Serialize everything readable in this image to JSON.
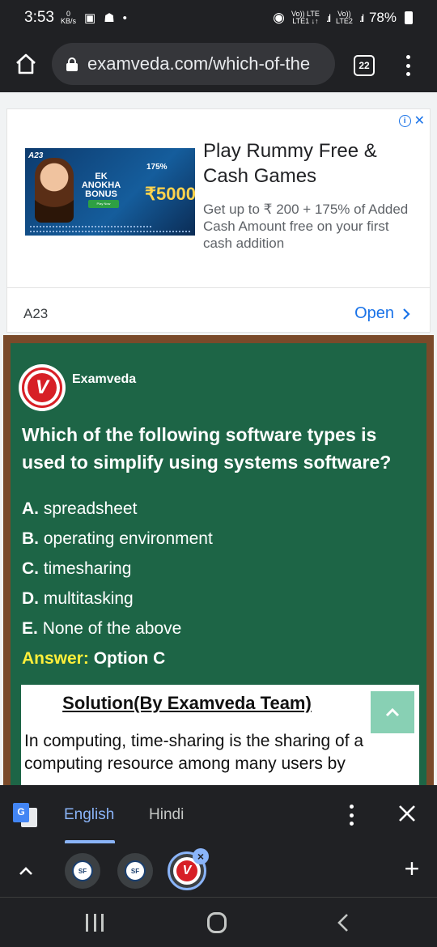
{
  "status_bar": {
    "time": "3:53",
    "net_speed_value": "0",
    "net_speed_unit": "KB/s",
    "lte1": "Vo)) LTE",
    "lte1_sub": "LTE1 ↓↑",
    "lte2": "Vo))",
    "lte2_sub": "LTE2",
    "battery": "78%"
  },
  "browser": {
    "url": "examveda.com/which-of-the",
    "tab_count": "22"
  },
  "ad": {
    "image": {
      "logo": "A23",
      "bonus_text": "EK ANOKHA BONUS",
      "percent": "175%",
      "amount": "₹5000",
      "button": "Play Now"
    },
    "title": "Play Rummy Free & Cash Games",
    "description": "Get up to ₹ 200 + 175% of Added Cash Amount free on your first cash addition",
    "advertiser": "A23",
    "open_label": "Open"
  },
  "content": {
    "brand_name": "Examveda",
    "brand_logo_letter": "V",
    "question": "Which of the following software types is used to simplify using systems software?",
    "options": [
      {
        "letter": "A.",
        "text": "spreadsheet"
      },
      {
        "letter": "B.",
        "text": "operating environment"
      },
      {
        "letter": "C.",
        "text": "timesharing"
      },
      {
        "letter": "D.",
        "text": "multitasking"
      },
      {
        "letter": "E.",
        "text": "None of the above"
      }
    ],
    "answer_label": "Answer:",
    "answer_value": "Option C",
    "solution_title": "Solution(By Examveda Team)",
    "solution_text": "In computing, time-sharing is the sharing of a computing resource among many users by"
  },
  "translate_bar": {
    "languages": [
      "English",
      "Hindi"
    ],
    "selected": "English"
  },
  "tab_strip": {
    "favicon_label": "SF"
  }
}
